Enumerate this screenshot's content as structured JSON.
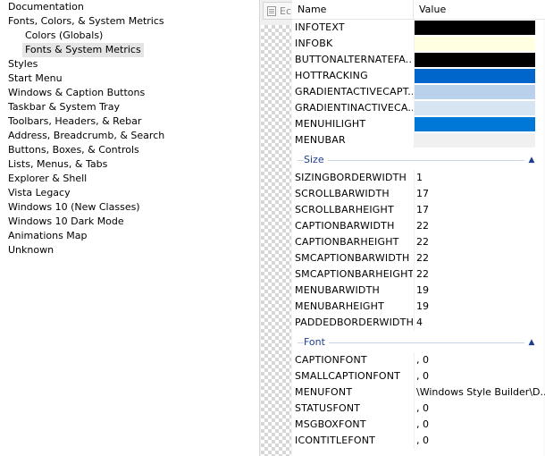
{
  "tree": {
    "items": [
      {
        "label": "Documentation",
        "indent": 0,
        "selected": false
      },
      {
        "label": "Fonts, Colors, & System Metrics",
        "indent": 0,
        "selected": false
      },
      {
        "label": "Colors (Globals)",
        "indent": 1,
        "selected": false
      },
      {
        "label": "Fonts & System Metrics",
        "indent": 1,
        "selected": true
      },
      {
        "label": "Styles",
        "indent": 0,
        "selected": false
      },
      {
        "label": "Start Menu",
        "indent": 0,
        "selected": false
      },
      {
        "label": "Windows & Caption Buttons",
        "indent": 0,
        "selected": false
      },
      {
        "label": "Taskbar & System Tray",
        "indent": 0,
        "selected": false
      },
      {
        "label": "Toolbars, Headers, & Rebar",
        "indent": 0,
        "selected": false
      },
      {
        "label": "Address, Breadcrumb, & Search",
        "indent": 0,
        "selected": false
      },
      {
        "label": "Buttons, Boxes, & Controls",
        "indent": 0,
        "selected": false
      },
      {
        "label": "Lists, Menus, & Tabs",
        "indent": 0,
        "selected": false
      },
      {
        "label": "Explorer & Shell",
        "indent": 0,
        "selected": false
      },
      {
        "label": "Vista Legacy",
        "indent": 0,
        "selected": false
      },
      {
        "label": "Windows 10 (New Classes)",
        "indent": 0,
        "selected": false
      },
      {
        "label": "Windows 10 Dark Mode",
        "indent": 0,
        "selected": false
      },
      {
        "label": "Animations Map",
        "indent": 0,
        "selected": false
      },
      {
        "label": "Unknown",
        "indent": 0,
        "selected": false
      }
    ]
  },
  "preview": {
    "tab_label": "Ec"
  },
  "grid": {
    "header": {
      "name": "Name",
      "value": "Value"
    },
    "color_rows": [
      {
        "name": "INFOTEXT",
        "color": "#000000"
      },
      {
        "name": "INFOBK",
        "color": "#ffffe1"
      },
      {
        "name": "BUTTONALTERNATEFA...",
        "color": "#000000"
      },
      {
        "name": "HOTTRACKING",
        "color": "#0066cc"
      },
      {
        "name": "GRADIENTACTIVECAPT...",
        "color": "#b9d1ea"
      },
      {
        "name": "GRADIENTINACTIVECA...",
        "color": "#d7e4f2"
      },
      {
        "name": "MENUHILIGHT",
        "color": "#0078d7"
      },
      {
        "name": "MENUBAR",
        "color": "#f0f0f0"
      }
    ],
    "size_group": {
      "label": "Size",
      "chevron": "^"
    },
    "size_rows": [
      {
        "name": "SIZINGBORDERWIDTH",
        "value": "1"
      },
      {
        "name": "SCROLLBARWIDTH",
        "value": "17"
      },
      {
        "name": "SCROLLBARHEIGHT",
        "value": "17"
      },
      {
        "name": "CAPTIONBARWIDTH",
        "value": "22"
      },
      {
        "name": "CAPTIONBARHEIGHT",
        "value": "22"
      },
      {
        "name": "SMCAPTIONBARWIDTH",
        "value": "22"
      },
      {
        "name": "SMCAPTIONBARHEIGHT",
        "value": "22"
      },
      {
        "name": "MENUBARWIDTH",
        "value": "19"
      },
      {
        "name": "MENUBARHEIGHT",
        "value": "19"
      },
      {
        "name": "PADDEDBORDERWIDTH",
        "value": "4"
      }
    ],
    "font_group": {
      "label": "Font",
      "chevron": "^"
    },
    "font_rows": [
      {
        "name": "CAPTIONFONT",
        "value": ", 0"
      },
      {
        "name": "SMALLCAPTIONFONT",
        "value": ", 0"
      },
      {
        "name": "MENUFONT",
        "value": "\\Windows Style Builder\\D..."
      },
      {
        "name": "STATUSFONT",
        "value": ", 0"
      },
      {
        "name": "MSGBOXFONT",
        "value": ", 0"
      },
      {
        "name": "ICONTITLEFONT",
        "value": ", 0"
      }
    ]
  }
}
